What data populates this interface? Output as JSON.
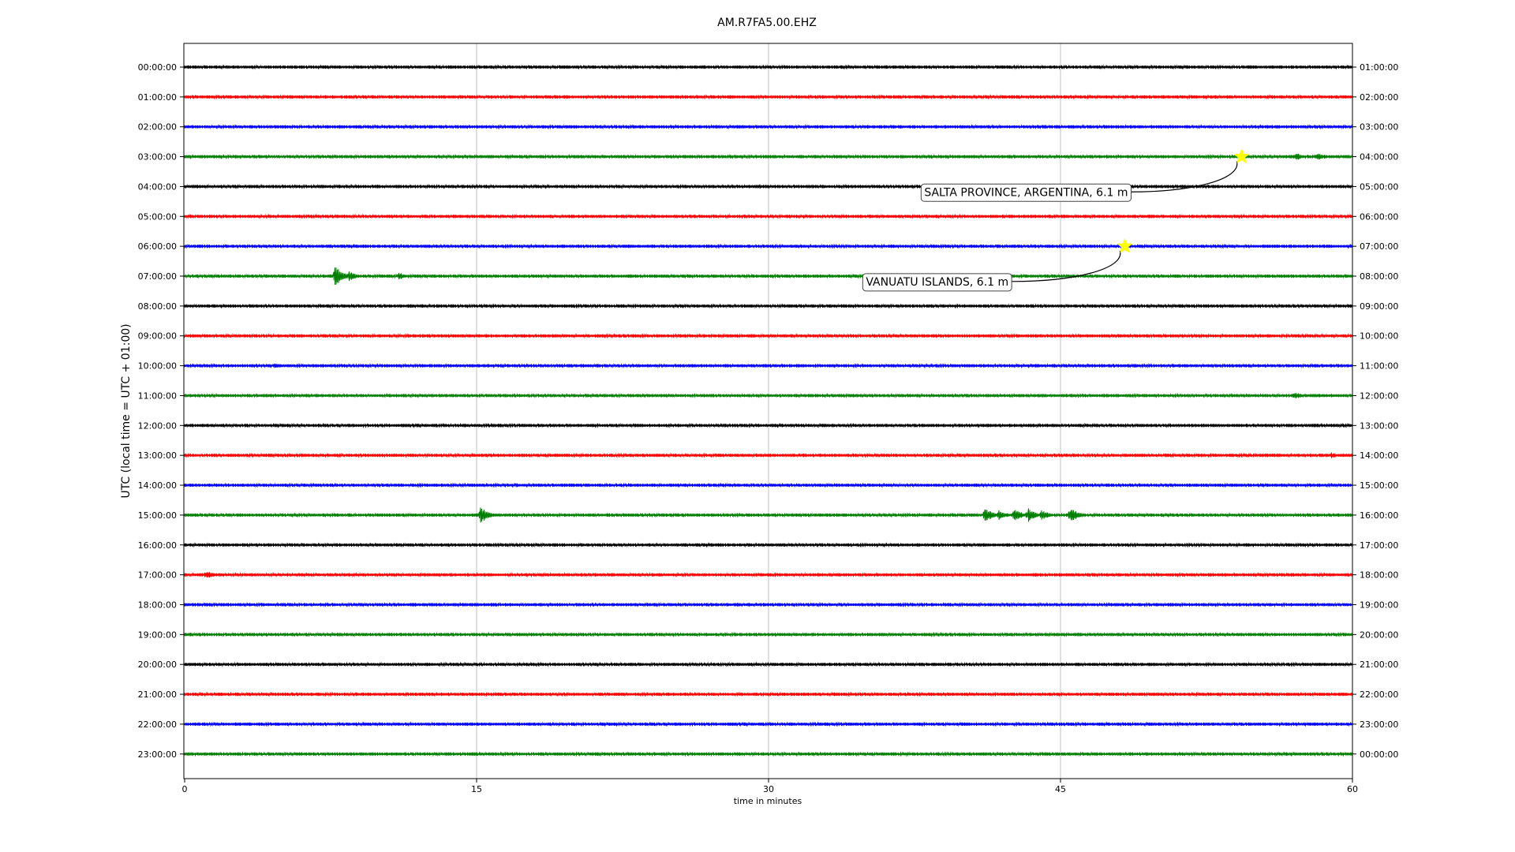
{
  "chart_data": {
    "type": "line",
    "title": "AM.R7FA5.00.EHZ",
    "xlabel": "time in minutes",
    "ylabel": "UTC (local time = UTC + 01:00)",
    "xlim": [
      0,
      60
    ],
    "x_ticks": [
      "0",
      "15",
      "30",
      "45",
      "60"
    ],
    "x_tick_values": [
      0,
      15,
      30,
      45,
      60
    ],
    "grid": "vertical lines at 15-minute ticks",
    "trace_colors": [
      "#000000",
      "#ff0000",
      "#0000ff",
      "#008000"
    ],
    "rows": [
      {
        "utc": "00:00:00",
        "local": "01:00:00"
      },
      {
        "utc": "01:00:00",
        "local": "02:00:00"
      },
      {
        "utc": "02:00:00",
        "local": "03:00:00"
      },
      {
        "utc": "03:00:00",
        "local": "04:00:00"
      },
      {
        "utc": "04:00:00",
        "local": "05:00:00"
      },
      {
        "utc": "05:00:00",
        "local": "06:00:00"
      },
      {
        "utc": "06:00:00",
        "local": "07:00:00"
      },
      {
        "utc": "07:00:00",
        "local": "08:00:00"
      },
      {
        "utc": "08:00:00",
        "local": "09:00:00"
      },
      {
        "utc": "09:00:00",
        "local": "10:00:00"
      },
      {
        "utc": "10:00:00",
        "local": "11:00:00"
      },
      {
        "utc": "11:00:00",
        "local": "12:00:00"
      },
      {
        "utc": "12:00:00",
        "local": "13:00:00"
      },
      {
        "utc": "13:00:00",
        "local": "14:00:00"
      },
      {
        "utc": "14:00:00",
        "local": "15:00:00"
      },
      {
        "utc": "15:00:00",
        "local": "16:00:00"
      },
      {
        "utc": "16:00:00",
        "local": "17:00:00"
      },
      {
        "utc": "17:00:00",
        "local": "18:00:00"
      },
      {
        "utc": "18:00:00",
        "local": "19:00:00"
      },
      {
        "utc": "19:00:00",
        "local": "20:00:00"
      },
      {
        "utc": "20:00:00",
        "local": "21:00:00"
      },
      {
        "utc": "21:00:00",
        "local": "22:00:00"
      },
      {
        "utc": "22:00:00",
        "local": "23:00:00"
      },
      {
        "utc": "23:00:00",
        "local": "00:00:00"
      }
    ],
    "bursts": [
      {
        "row": 3,
        "minute": 57.1,
        "amp": 5
      },
      {
        "row": 3,
        "minute": 58.2,
        "amp": 6
      },
      {
        "row": 4,
        "minute": 7.0,
        "amp": 4
      },
      {
        "row": 4,
        "minute": 29.5,
        "amp": 3
      },
      {
        "row": 7,
        "minute": 7.7,
        "amp": 16
      },
      {
        "row": 7,
        "minute": 8.4,
        "amp": 7
      },
      {
        "row": 7,
        "minute": 11.0,
        "amp": 5
      },
      {
        "row": 10,
        "minute": 4.6,
        "amp": 4
      },
      {
        "row": 11,
        "minute": 57.0,
        "amp": 5
      },
      {
        "row": 13,
        "minute": 58.9,
        "amp": 4
      },
      {
        "row": 14,
        "minute": 17.0,
        "amp": 3
      },
      {
        "row": 15,
        "minute": 15.2,
        "amp": 11
      },
      {
        "row": 15,
        "minute": 41.1,
        "amp": 10
      },
      {
        "row": 15,
        "minute": 41.8,
        "amp": 7
      },
      {
        "row": 15,
        "minute": 42.6,
        "amp": 9
      },
      {
        "row": 15,
        "minute": 43.3,
        "amp": 10
      },
      {
        "row": 15,
        "minute": 44.0,
        "amp": 7
      },
      {
        "row": 15,
        "minute": 45.5,
        "amp": 11
      },
      {
        "row": 17,
        "minute": 1.1,
        "amp": 6
      },
      {
        "row": 18,
        "minute": 12.0,
        "amp": 3
      },
      {
        "row": 18,
        "minute": 13.7,
        "amp": 3
      },
      {
        "row": 18,
        "minute": 15.7,
        "amp": 3
      },
      {
        "row": 21,
        "minute": 33.3,
        "amp": 3
      },
      {
        "row": 21,
        "minute": 36.2,
        "amp": 3
      }
    ],
    "events": [
      {
        "label": "SALTA PROVINCE, ARGENTINA, 6.1 m",
        "row": 3,
        "minute": 54.3,
        "label_row": 4.18,
        "label_minute": 38.0
      },
      {
        "label": "VANUATU ISLANDS, 6.1 m",
        "row": 6,
        "minute": 48.3,
        "label_row": 7.18,
        "label_minute": 35.0
      }
    ],
    "event_marker_color": "#ffff00"
  }
}
